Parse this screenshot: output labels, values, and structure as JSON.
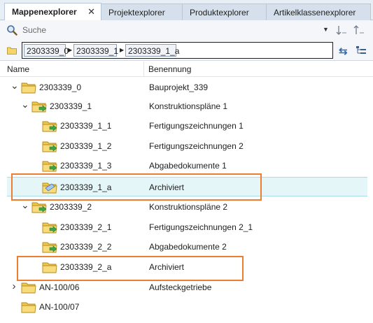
{
  "tabs": [
    {
      "label": "Mappenexplorer",
      "active": true
    },
    {
      "label": "Projektexplorer",
      "active": false
    },
    {
      "label": "Produktexplorer",
      "active": false
    },
    {
      "label": "Artikelklassenexplorer",
      "active": false
    }
  ],
  "search": {
    "label": "Suche"
  },
  "path": {
    "segments": [
      "2303339_0",
      "2303339_1",
      "2303339_1_a"
    ]
  },
  "columns": {
    "name": "Name",
    "description": "Benennung"
  },
  "rows": [
    {
      "name": "2303339_0",
      "description": "Bauprojekt_339",
      "expanded": true,
      "folder": "plain",
      "selected": false
    },
    {
      "name": "2303339_1",
      "description": "Konstruktionspläne 1",
      "expanded": true,
      "folder": "arrow",
      "selected": false
    },
    {
      "name": "2303339_1_1",
      "description": "Fertigungszeichnungen 1",
      "expanded": null,
      "folder": "arrow",
      "selected": false
    },
    {
      "name": "2303339_1_2",
      "description": "Fertigungszeichnungen 2",
      "expanded": null,
      "folder": "arrow",
      "selected": false
    },
    {
      "name": "2303339_1_3",
      "description": "Abgabedokumente 1",
      "expanded": null,
      "folder": "arrow",
      "selected": false
    },
    {
      "name": "2303339_1_a",
      "description": "Archiviert",
      "expanded": null,
      "folder": "archive",
      "selected": true
    },
    {
      "name": "2303339_2",
      "description": "Konstruktionspläne 2",
      "expanded": true,
      "folder": "arrow",
      "selected": false
    },
    {
      "name": "2303339_2_1",
      "description": "Fertigungszeichnungen 2_1",
      "expanded": null,
      "folder": "arrow",
      "selected": false
    },
    {
      "name": "2303339_2_2",
      "description": "Abgabedokumente 2",
      "expanded": null,
      "folder": "arrow",
      "selected": false
    },
    {
      "name": "2303339_2_a",
      "description": "Archiviert",
      "expanded": null,
      "folder": "plain",
      "selected": false
    },
    {
      "name": "AN-100/06",
      "description": "Aufsteckgetriebe",
      "expanded": false,
      "folder": "plain",
      "selected": false
    },
    {
      "name": "AN-100/07",
      "description": "",
      "expanded": null,
      "folder": "plain",
      "selected": false
    }
  ],
  "colors": {
    "highlight": "#ed7d31",
    "selection": "#e4f6f8",
    "folder": "#f5d56b",
    "arrow": "#3aa64a"
  }
}
